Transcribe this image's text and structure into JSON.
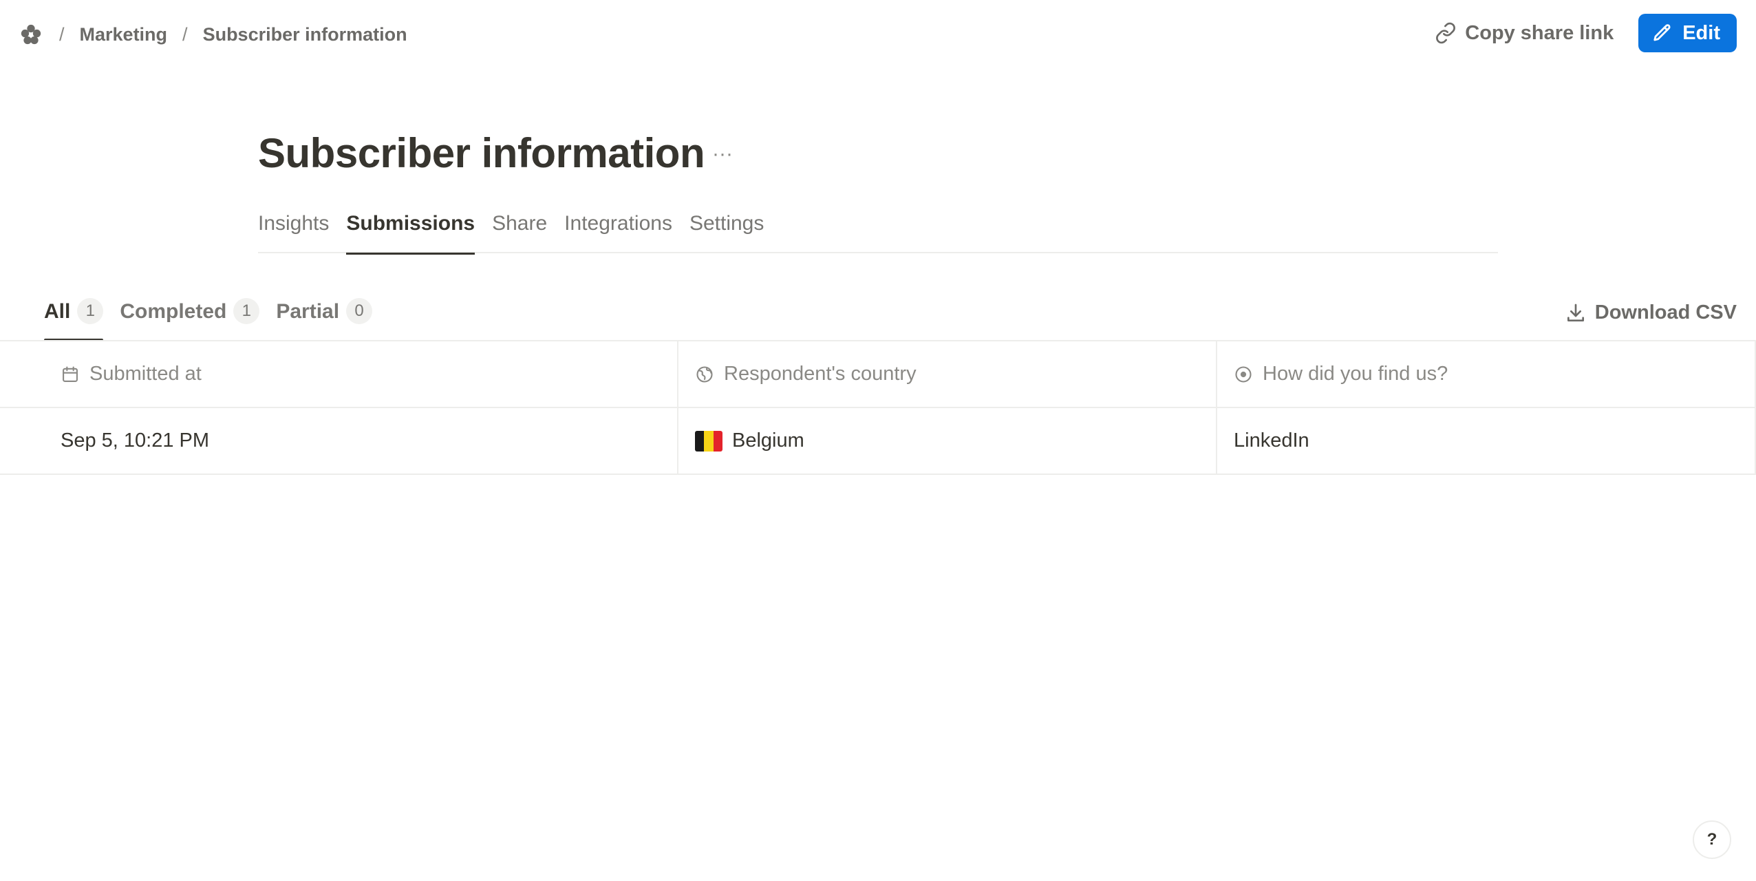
{
  "breadcrumb": {
    "logo_icon": "flower-logo-icon",
    "items": [
      "Marketing",
      "Subscriber information"
    ],
    "separator": "/"
  },
  "actions": {
    "copy_share_link": "Copy share link",
    "edit": "Edit",
    "accent_color": "#0b74de"
  },
  "form": {
    "title": "Subscriber information",
    "more": "···"
  },
  "main_tabs": [
    {
      "label": "Insights",
      "active": false
    },
    {
      "label": "Submissions",
      "active": true
    },
    {
      "label": "Share",
      "active": false
    },
    {
      "label": "Integrations",
      "active": false
    },
    {
      "label": "Settings",
      "active": false
    }
  ],
  "filter_tabs": [
    {
      "label": "All",
      "count": "1",
      "active": true
    },
    {
      "label": "Completed",
      "count": "1",
      "active": false
    },
    {
      "label": "Partial",
      "count": "0",
      "active": false
    }
  ],
  "download_csv": "Download CSV",
  "table": {
    "columns": [
      {
        "label": "Submitted at",
        "icon": "calendar-icon"
      },
      {
        "label": "Respondent's country",
        "icon": "globe-icon"
      },
      {
        "label": "How did you find us?",
        "icon": "radio-icon"
      }
    ],
    "rows": [
      {
        "submitted_at": "Sep 5, 10:21 PM",
        "country": "Belgium",
        "country_flag": "belgium-flag-icon",
        "found_us": "LinkedIn"
      }
    ]
  },
  "help": "?"
}
